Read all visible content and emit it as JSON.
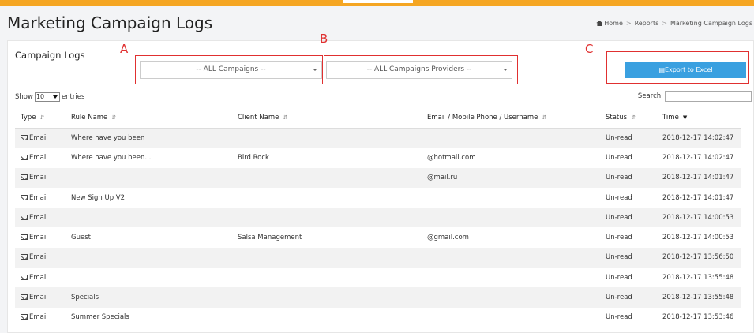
{
  "page": {
    "title": "Marketing Campaign Logs",
    "breadcrumb": [
      "Home",
      "Reports",
      "Marketing Campaign Logs"
    ]
  },
  "card": {
    "title": "Campaign Logs",
    "annotations": [
      "A",
      "B",
      "C"
    ],
    "campaign_select": "-- ALL Campaigns --",
    "provider_select": "-- ALL Campaigns Providers --",
    "export_label": "Export to Excel"
  },
  "table_controls": {
    "show_label": "Show",
    "entries_value": "10",
    "entries_label": "entries",
    "search_label": "Search:"
  },
  "table": {
    "headers": [
      "Type",
      "Rule Name",
      "Client Name",
      "Email / Mobile Phone / Username",
      "Status",
      "Time"
    ],
    "rows": [
      {
        "type": "Email",
        "rule": "Where have you been",
        "client": "",
        "email": "",
        "status": "Un-read",
        "time": "2018-12-17 14:02:47"
      },
      {
        "type": "Email",
        "rule": "Where have you been...",
        "client": "Bird Rock",
        "email": "@hotmail.com",
        "status": "Un-read",
        "time": "2018-12-17 14:02:47"
      },
      {
        "type": "Email",
        "rule": "",
        "client": "",
        "email": "@mail.ru",
        "status": "Un-read",
        "time": "2018-12-17 14:01:47"
      },
      {
        "type": "Email",
        "rule": "New Sign Up V2",
        "client": "",
        "email": "",
        "status": "Un-read",
        "time": "2018-12-17 14:01:47"
      },
      {
        "type": "Email",
        "rule": "",
        "client": "",
        "email": "",
        "status": "Un-read",
        "time": "2018-12-17 14:00:53"
      },
      {
        "type": "Email",
        "rule": "Guest",
        "client": "Salsa Management",
        "email": "@gmail.com",
        "status": "Un-read",
        "time": "2018-12-17 14:00:53"
      },
      {
        "type": "Email",
        "rule": "",
        "client": "",
        "email": "",
        "status": "Un-read",
        "time": "2018-12-17 13:56:50"
      },
      {
        "type": "Email",
        "rule": "",
        "client": "",
        "email": "",
        "status": "Un-read",
        "time": "2018-12-17 13:55:48"
      },
      {
        "type": "Email",
        "rule": "Specials",
        "client": "",
        "email": "",
        "status": "Un-read",
        "time": "2018-12-17 13:55:48"
      },
      {
        "type": "Email",
        "rule": "Summer Specials",
        "client": "",
        "email": "",
        "status": "Un-read",
        "time": "2018-12-17 13:53:46"
      }
    ]
  },
  "colors": {
    "topbar": "#f5a623",
    "export_button": "#3aa0e0",
    "annotation_red": "#e03030"
  },
  "icons": {
    "type_icon": "envelope-icon",
    "breadcrumb_home": "home-icon",
    "export_icon": "file-excel-icon"
  }
}
